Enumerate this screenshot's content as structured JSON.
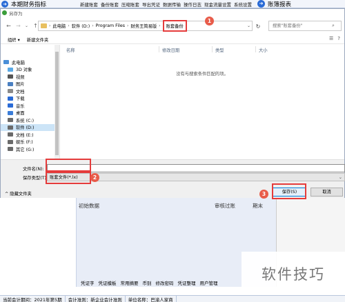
{
  "app": {
    "title": "本期财务指标",
    "menu": [
      "新建账套",
      "备份账套",
      "压缩账套",
      "导出凭证",
      "数据传输",
      "操作日志",
      "现金流量设置",
      "系统设置"
    ],
    "ledger_label": "账簿报表",
    "lower_columns": [
      "初始数据",
      "审核过账",
      "期末"
    ],
    "functions": [
      "凭证字",
      "凭证模板",
      "常用摘要",
      "币别",
      "修改密码",
      "凭证整理",
      "用户管理"
    ],
    "status": [
      "当前会计期间：2021年第5期",
      "会计准则：新企业会计准则",
      "单位名称：巴渝人家商"
    ]
  },
  "dialog": {
    "title": "另存为",
    "breadcrumb": [
      "此电脑",
      "软件 (D:)",
      "Program Files",
      "财务王简易版",
      "账套备份"
    ],
    "search_placeholder": "搜索\"账套备份\"",
    "toolbar": {
      "organize": "组织 ▾",
      "new_folder": "新建文件夹"
    },
    "nav_items": [
      {
        "label": "此电脑",
        "icon": "computer-icon",
        "color": "#4a8fd8"
      },
      {
        "label": "3D 对象",
        "icon": "3d-objects-icon",
        "color": "#5aa9e6"
      },
      {
        "label": "视频",
        "icon": "video-icon",
        "color": "#555555"
      },
      {
        "label": "图片",
        "icon": "pictures-icon",
        "color": "#4a7fc1"
      },
      {
        "label": "文档",
        "icon": "documents-icon",
        "color": "#8a8a8a"
      },
      {
        "label": "下载",
        "icon": "download-icon",
        "color": "#2a6bd6"
      },
      {
        "label": "音乐",
        "icon": "music-icon",
        "color": "#2a6bd6"
      },
      {
        "label": "桌面",
        "icon": "desktop-icon",
        "color": "#3b7dd8"
      },
      {
        "label": "系统 (C:)",
        "icon": "drive-icon",
        "color": "#6a6a6a"
      },
      {
        "label": "软件 (D:)",
        "icon": "drive-icon",
        "color": "#6a6a6a"
      },
      {
        "label": "文档 (E:)",
        "icon": "drive-icon",
        "color": "#6a6a6a"
      },
      {
        "label": "娱乐 (F:)",
        "icon": "drive-icon",
        "color": "#6a6a6a"
      },
      {
        "label": "其它 (G:)",
        "icon": "drive-icon",
        "color": "#6a6a6a"
      }
    ],
    "columns": [
      "名称",
      "修改日期",
      "类型",
      "大小"
    ],
    "empty_text": "没有与搜索条件匹配的项。",
    "filename_label": "文件名(N):",
    "filename_value": "",
    "filetype_label": "保存类型(T):",
    "filetype_value": "账套文件(*.lx)",
    "hide_folders": "隐藏文件夹",
    "save_label": "保存(S)",
    "cancel_label": "取消"
  },
  "annotations": [
    "1",
    "2",
    "3"
  ],
  "watermark": "软件技巧",
  "colors": {
    "highlight": "#e53b3b",
    "accent": "#0078d7",
    "selected": "#cce4f7"
  }
}
